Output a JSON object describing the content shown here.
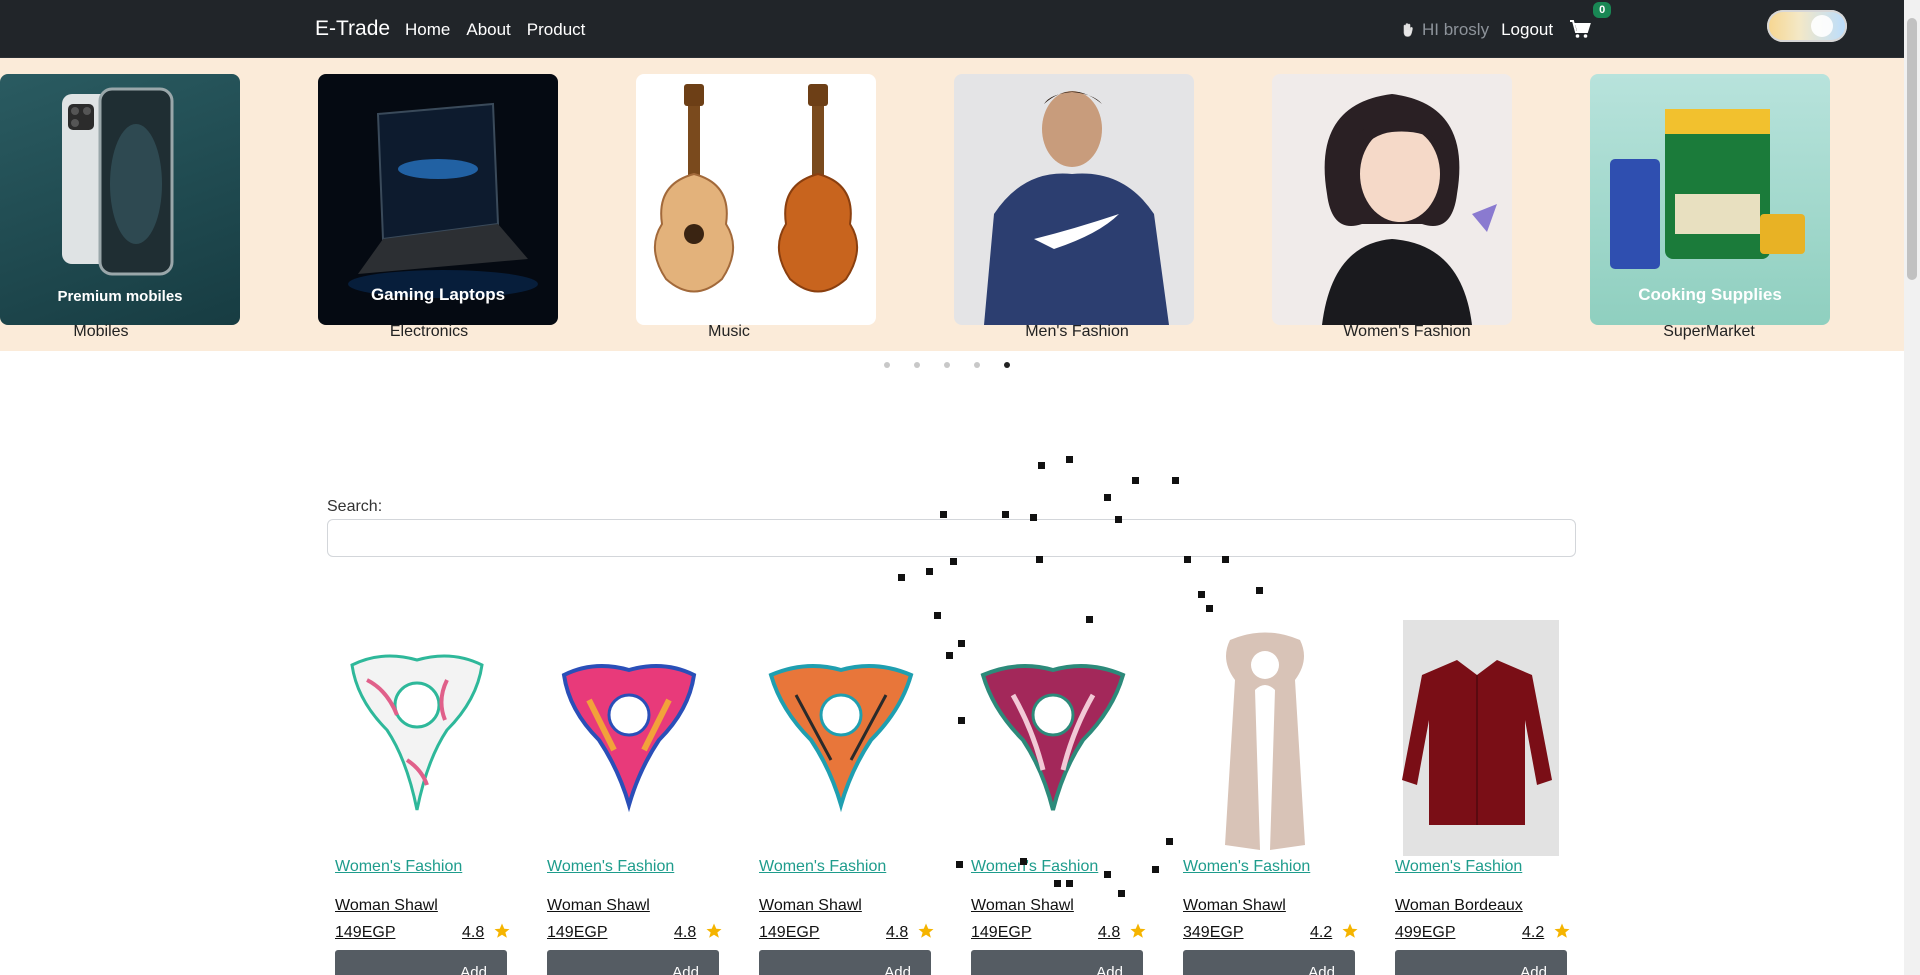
{
  "navbar": {
    "brand": "E-Trade",
    "links": [
      "Home",
      "About",
      "Product"
    ],
    "greeting": "HI brosly",
    "logout": "Logout",
    "cart_count": "0"
  },
  "categories": [
    {
      "label": "Mobiles",
      "banner_text": "Premium mobiles"
    },
    {
      "label": "Electronics",
      "banner_text": "Gaming Laptops"
    },
    {
      "label": "Music",
      "banner_text": ""
    },
    {
      "label": "Men's Fashion",
      "banner_text": ""
    },
    {
      "label": "Women's Fashion",
      "banner_text": ""
    },
    {
      "label": "SuperMarket",
      "banner_text": "Cooking Supplies"
    }
  ],
  "carousel": {
    "total": 5,
    "active": 5
  },
  "search": {
    "label": "Search:",
    "placeholder": ""
  },
  "products": [
    {
      "category": "Women's Fashion",
      "name": "Woman Shawl",
      "price": "149EGP",
      "rating": "4.8",
      "button": "Add"
    },
    {
      "category": "Women's Fashion",
      "name": "Woman Shawl",
      "price": "149EGP",
      "rating": "4.8",
      "button": "Add"
    },
    {
      "category": "Women's Fashion",
      "name": "Woman Shawl",
      "price": "149EGP",
      "rating": "4.8",
      "button": "Add"
    },
    {
      "category": "Women's Fashion",
      "name": "Woman Shawl",
      "price": "149EGP",
      "rating": "4.8",
      "button": "Add"
    },
    {
      "category": "Women's Fashion",
      "name": "Woman Shawl",
      "price": "349EGP",
      "rating": "4.2",
      "button": "Add"
    },
    {
      "category": "Women's Fashion",
      "name": "Woman Bordeaux",
      "price": "499EGP",
      "rating": "4.2",
      "button": "Add"
    }
  ],
  "colors": {
    "navbar_bg": "#212529",
    "banner_bg": "#fbebd9",
    "category_link": "#1e9c8c",
    "badge": "#198754",
    "star": "#f5b400",
    "add_button": "#555c63"
  }
}
